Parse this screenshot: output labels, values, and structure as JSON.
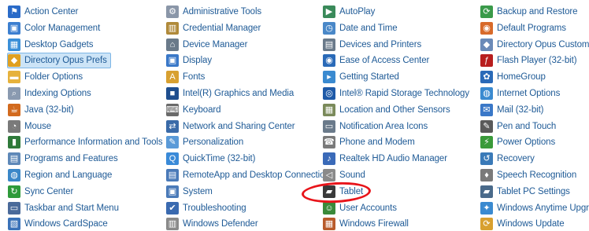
{
  "control_panel": {
    "columns": [
      [
        {
          "label": "Action Center",
          "icon": "flag-icon",
          "color": "#2a6bc8"
        },
        {
          "label": "Color Management",
          "icon": "monitor-color-icon",
          "color": "#3c7fd0"
        },
        {
          "label": "Desktop Gadgets",
          "icon": "gadgets-icon",
          "color": "#3a8fd8"
        },
        {
          "label": "Directory Opus Prefs",
          "icon": "directory-opus-icon",
          "color": "#e0a020",
          "selected": true
        },
        {
          "label": "Folder Options",
          "icon": "folder-icon",
          "color": "#e6b23c"
        },
        {
          "label": "Indexing Options",
          "icon": "indexing-icon",
          "color": "#8a9ab0"
        },
        {
          "label": "Java (32-bit)",
          "icon": "java-icon",
          "color": "#d26a1e"
        },
        {
          "label": "Mouse",
          "icon": "mouse-icon",
          "color": "#7a7a7a"
        },
        {
          "label": "Performance Information and Tools",
          "icon": "performance-icon",
          "color": "#2f7a3a"
        },
        {
          "label": "Programs and Features",
          "icon": "programs-icon",
          "color": "#5e88b8"
        },
        {
          "label": "Region and Language",
          "icon": "globe-icon",
          "color": "#3b87c8"
        },
        {
          "label": "Sync Center",
          "icon": "sync-icon",
          "color": "#2e9a3a"
        },
        {
          "label": "Taskbar and Start Menu",
          "icon": "taskbar-icon",
          "color": "#4a6a9a"
        },
        {
          "label": "Windows CardSpace",
          "icon": "cardspace-icon",
          "color": "#3a72b8"
        }
      ],
      [
        {
          "label": "Administrative Tools",
          "icon": "admin-tools-icon",
          "color": "#8a96a8"
        },
        {
          "label": "Credential Manager",
          "icon": "credential-icon",
          "color": "#b08a3a"
        },
        {
          "label": "Device Manager",
          "icon": "device-manager-icon",
          "color": "#6a7a8a"
        },
        {
          "label": "Display",
          "icon": "display-icon",
          "color": "#3a78c8"
        },
        {
          "label": "Fonts",
          "icon": "fonts-icon",
          "color": "#d8a030"
        },
        {
          "label": "Intel(R) Graphics and Media",
          "icon": "intel-graphics-icon",
          "color": "#1e4e8e"
        },
        {
          "label": "Keyboard",
          "icon": "keyboard-icon",
          "color": "#6a6a6a"
        },
        {
          "label": "Network and Sharing Center",
          "icon": "network-icon",
          "color": "#3a6aa8"
        },
        {
          "label": "Personalization",
          "icon": "personalization-icon",
          "color": "#5a9ad8"
        },
        {
          "label": "QuickTime (32-bit)",
          "icon": "quicktime-icon",
          "color": "#3a8ad8"
        },
        {
          "label": "RemoteApp and Desktop Connections",
          "icon": "remoteapp-icon",
          "color": "#4a7ab8"
        },
        {
          "label": "System",
          "icon": "system-icon",
          "color": "#4a7ab8"
        },
        {
          "label": "Troubleshooting",
          "icon": "troubleshooting-icon",
          "color": "#3a6ab0"
        },
        {
          "label": "Windows Defender",
          "icon": "defender-icon",
          "color": "#8a8a8a"
        }
      ],
      [
        {
          "label": "AutoPlay",
          "icon": "autoplay-icon",
          "color": "#3a8a5a"
        },
        {
          "label": "Date and Time",
          "icon": "clock-icon",
          "color": "#4a88c8"
        },
        {
          "label": "Devices and Printers",
          "icon": "printer-icon",
          "color": "#6a7a8a"
        },
        {
          "label": "Ease of Access Center",
          "icon": "ease-of-access-icon",
          "color": "#2a6ab8"
        },
        {
          "label": "Getting Started",
          "icon": "getting-started-icon",
          "color": "#3a8ad0"
        },
        {
          "label": "Intel® Rapid Storage Technology",
          "icon": "intel-storage-icon",
          "color": "#1e5aa8"
        },
        {
          "label": "Location and Other Sensors",
          "icon": "sensors-icon",
          "color": "#7a8a5a"
        },
        {
          "label": "Notification Area Icons",
          "icon": "notification-icon",
          "color": "#6a7a8a"
        },
        {
          "label": "Phone and Modem",
          "icon": "phone-icon",
          "color": "#7a7a7a"
        },
        {
          "label": "Realtek HD Audio Manager",
          "icon": "audio-manager-icon",
          "color": "#3a6ab8"
        },
        {
          "label": "Sound",
          "icon": "speaker-icon",
          "color": "#8a8a8a"
        },
        {
          "label": "Tablet",
          "icon": "tablet-icon",
          "color": "#3a3a3a",
          "circled": true
        },
        {
          "label": "User Accounts",
          "icon": "user-accounts-icon",
          "color": "#3a8a3a"
        },
        {
          "label": "Windows Firewall",
          "icon": "firewall-icon",
          "color": "#b85a2a"
        }
      ],
      [
        {
          "label": "Backup and Restore",
          "icon": "backup-icon",
          "color": "#3a9a4a"
        },
        {
          "label": "Default Programs",
          "icon": "default-programs-icon",
          "color": "#d86a2a"
        },
        {
          "label": "Directory Opus Customize",
          "icon": "directory-opus-customize-icon",
          "color": "#6a8ab8"
        },
        {
          "label": "Flash Player (32-bit)",
          "icon": "flash-icon",
          "color": "#b81e1e"
        },
        {
          "label": "HomeGroup",
          "icon": "homegroup-icon",
          "color": "#2a6ab8"
        },
        {
          "label": "Internet Options",
          "icon": "internet-options-icon",
          "color": "#3a8ad0"
        },
        {
          "label": "Mail (32-bit)",
          "icon": "mail-icon",
          "color": "#3a78c8"
        },
        {
          "label": "Pen and Touch",
          "icon": "pen-icon",
          "color": "#5a5a5a"
        },
        {
          "label": "Power Options",
          "icon": "power-icon",
          "color": "#3a9a3a"
        },
        {
          "label": "Recovery",
          "icon": "recovery-icon",
          "color": "#3a7ab8"
        },
        {
          "label": "Speech Recognition",
          "icon": "microphone-icon",
          "color": "#7a7a7a"
        },
        {
          "label": "Tablet PC Settings",
          "icon": "tablet-pc-settings-icon",
          "color": "#4a6a8a"
        },
        {
          "label": "Windows Anytime Upgrade",
          "icon": "anytime-upgrade-icon",
          "color": "#3a8ad0"
        },
        {
          "label": "Windows Update",
          "icon": "windows-update-icon",
          "color": "#d8a030"
        }
      ]
    ]
  }
}
